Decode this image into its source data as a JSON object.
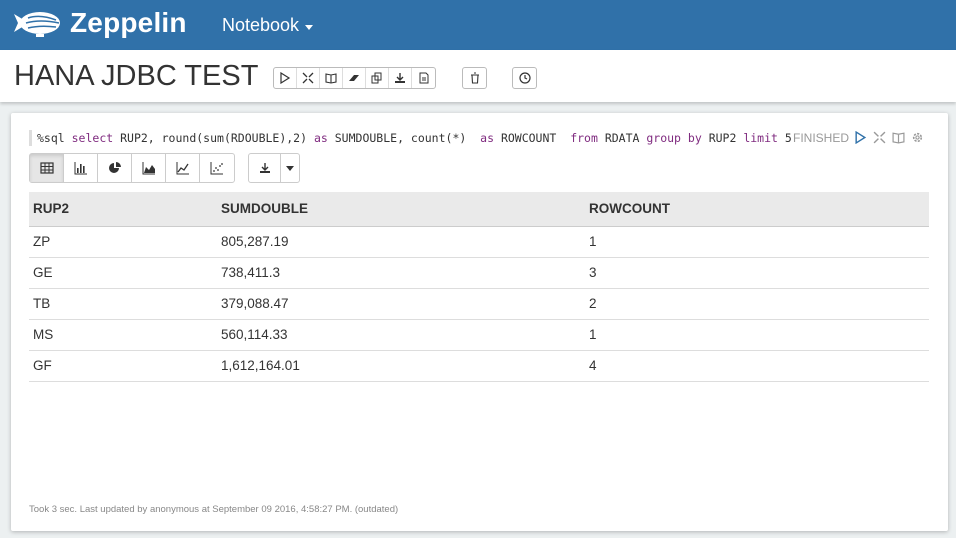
{
  "navbar": {
    "brand": "Zeppelin",
    "menu_label": "Notebook"
  },
  "notebook": {
    "title": "HANA JDBC TEST",
    "toolbar_icons": [
      "run-all-icon",
      "toggle-code-icon",
      "toggle-output-icon",
      "clear-output-icon",
      "clone-icon",
      "export-icon",
      "version-icon"
    ],
    "delete_icon": "trash-icon",
    "scheduler_icon": "clock-icon"
  },
  "paragraph": {
    "code": {
      "t1": "%sql ",
      "k1": "select",
      "t2": " RUP2, round(sum(RDOUBLE),2) ",
      "k2": "as",
      "t3": " SUMDOUBLE, count(*)  ",
      "k3": "as",
      "t4": " ROWCOUNT  ",
      "k4": "from",
      "t5": " RDATA ",
      "k5": "group",
      "t6": " ",
      "k6": "by",
      "t7": " RUP2 ",
      "k7": "limit",
      "t8": " 5"
    },
    "status": "FINISHED",
    "viz_buttons": [
      "table-icon",
      "bar-chart-icon",
      "pie-chart-icon",
      "area-chart-icon",
      "line-chart-icon",
      "scatter-chart-icon"
    ],
    "table": {
      "columns": [
        "RUP2",
        "SUMDOUBLE",
        "ROWCOUNT"
      ],
      "rows": [
        [
          "ZP",
          "805,287.19",
          "1"
        ],
        [
          "GE",
          "738,411.3",
          "3"
        ],
        [
          "TB",
          "379,088.47",
          "2"
        ],
        [
          "MS",
          "560,114.33",
          "1"
        ],
        [
          "GF",
          "1,612,164.01",
          "4"
        ]
      ]
    },
    "footer": "Took 3 sec. Last updated by anonymous at September 09 2016, 4:58:27 PM. (outdated)"
  },
  "colors": {
    "navbar": "#3071a9",
    "keyword": "#802c80",
    "status": "#999999"
  }
}
